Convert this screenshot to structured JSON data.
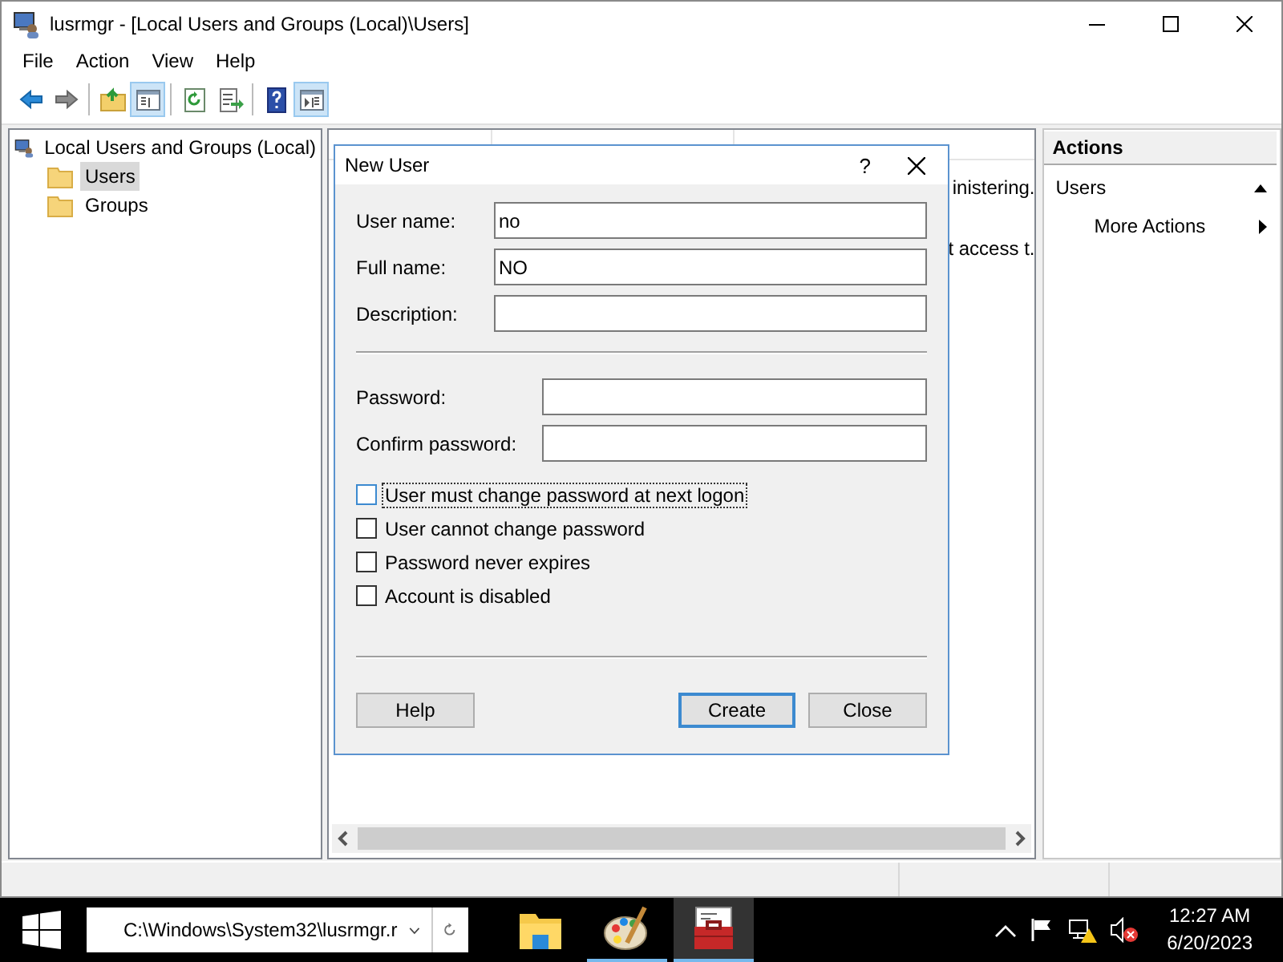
{
  "window": {
    "title": "lusrmgr - [Local Users and Groups (Local)\\Users]"
  },
  "menu": [
    "File",
    "Action",
    "View",
    "Help"
  ],
  "toolbar": [
    {
      "kind": "back",
      "pressed": false
    },
    {
      "kind": "forward",
      "pressed": false
    },
    {
      "kind": "sep"
    },
    {
      "kind": "up",
      "pressed": false
    },
    {
      "kind": "tree",
      "pressed": true
    },
    {
      "kind": "sep"
    },
    {
      "kind": "refresh",
      "pressed": false
    },
    {
      "kind": "export",
      "pressed": false
    },
    {
      "kind": "sep"
    },
    {
      "kind": "help",
      "pressed": false
    },
    {
      "kind": "pane",
      "pressed": true
    }
  ],
  "tree": [
    {
      "label": "Local Users and Groups (Local)",
      "kind": "computer",
      "selected": false,
      "children": [
        {
          "label": "Users",
          "kind": "folder",
          "selected": true
        },
        {
          "label": "Groups",
          "kind": "folder",
          "selected": false
        }
      ]
    }
  ],
  "list": {
    "rows": [
      {
        "description": "inistering."
      },
      {
        "description": "t access t."
      }
    ]
  },
  "actions": {
    "title": "Actions",
    "sections": [
      {
        "label": "Users",
        "expanded": true,
        "items": [
          {
            "label": "More Actions",
            "kind": "submenu"
          }
        ]
      }
    ]
  },
  "dialog": {
    "title": "New User",
    "help": "?",
    "identity_fields": [
      {
        "label": "User name:",
        "value": "no"
      },
      {
        "label": "Full name:",
        "value": "NO"
      },
      {
        "label": "Description:"
      }
    ],
    "password_fields": [
      {
        "label": "Password:"
      },
      {
        "label": "Confirm password:"
      }
    ],
    "checkboxes": [
      {
        "label": "User must change password at next logon",
        "checked": false,
        "focused": true
      },
      {
        "label": "User cannot change password",
        "checked": false,
        "focused": false
      },
      {
        "label": "Password never expires",
        "checked": false,
        "focused": false
      },
      {
        "label": "Account is disabled",
        "checked": false,
        "focused": false
      }
    ],
    "buttons": [
      {
        "label": "Help",
        "default": false
      },
      {
        "label": "Create",
        "default": true
      },
      {
        "label": "Close",
        "default": false
      }
    ]
  },
  "taskbar": {
    "address": "C:\\Windows\\System32\\lusrmgr.r",
    "apps": [
      {
        "kind": "explorer",
        "running": false,
        "active": false
      },
      {
        "kind": "paint",
        "running": true,
        "active": false
      },
      {
        "kind": "toolbox",
        "running": true,
        "active": true
      }
    ],
    "clock": {
      "time": "12:27 AM",
      "date": "6/20/2023"
    }
  }
}
